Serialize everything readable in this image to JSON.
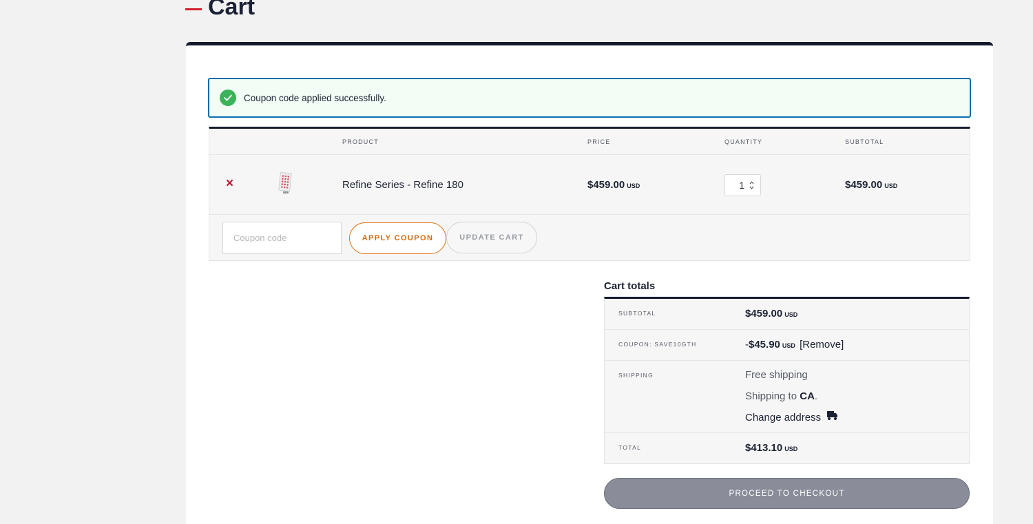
{
  "page": {
    "title": "Cart"
  },
  "notice": {
    "message": "Coupon code applied successfully."
  },
  "cart_table": {
    "headers": {
      "product": "PRODUCT",
      "price": "PRICE",
      "quantity": "QUANTITY",
      "subtotal": "SUBTOTAL"
    },
    "items": [
      {
        "remove": "×",
        "name": "Refine Series - Refine 180",
        "price": "$459.00",
        "price_currency": "USD",
        "quantity": "1",
        "subtotal": "$459.00",
        "subtotal_currency": "USD"
      }
    ],
    "coupon_placeholder": "Coupon code",
    "apply_coupon_label": "APPLY COUPON",
    "update_cart_label": "UPDATE CART"
  },
  "totals": {
    "title": "Cart totals",
    "subtotal_label": "SUBTOTAL",
    "subtotal_value": "$459.00",
    "subtotal_currency": "USD",
    "coupon_label": "COUPON: SAVE10GTH",
    "coupon_minus": "-",
    "coupon_value": "$45.90",
    "coupon_currency": "USD",
    "coupon_remove": "[Remove]",
    "shipping_label": "SHIPPING",
    "shipping_method": "Free shipping",
    "shipping_to_prefix": "Shipping to ",
    "shipping_to_region": "CA",
    "shipping_to_suffix": ".",
    "change_address": "Change address",
    "total_label": "TOTAL",
    "total_value": "$413.10",
    "total_currency": "USD"
  },
  "checkout": {
    "label": "PROCEED TO CHECKOUT"
  },
  "icons": {
    "notice": "check-circle-icon",
    "change_address": "truck-icon",
    "remove": "close-icon"
  },
  "colors": {
    "accent_orange": "#d46a10",
    "remove_red": "#c8102e",
    "success_green": "#3cb35a",
    "navy": "#141b2e"
  }
}
